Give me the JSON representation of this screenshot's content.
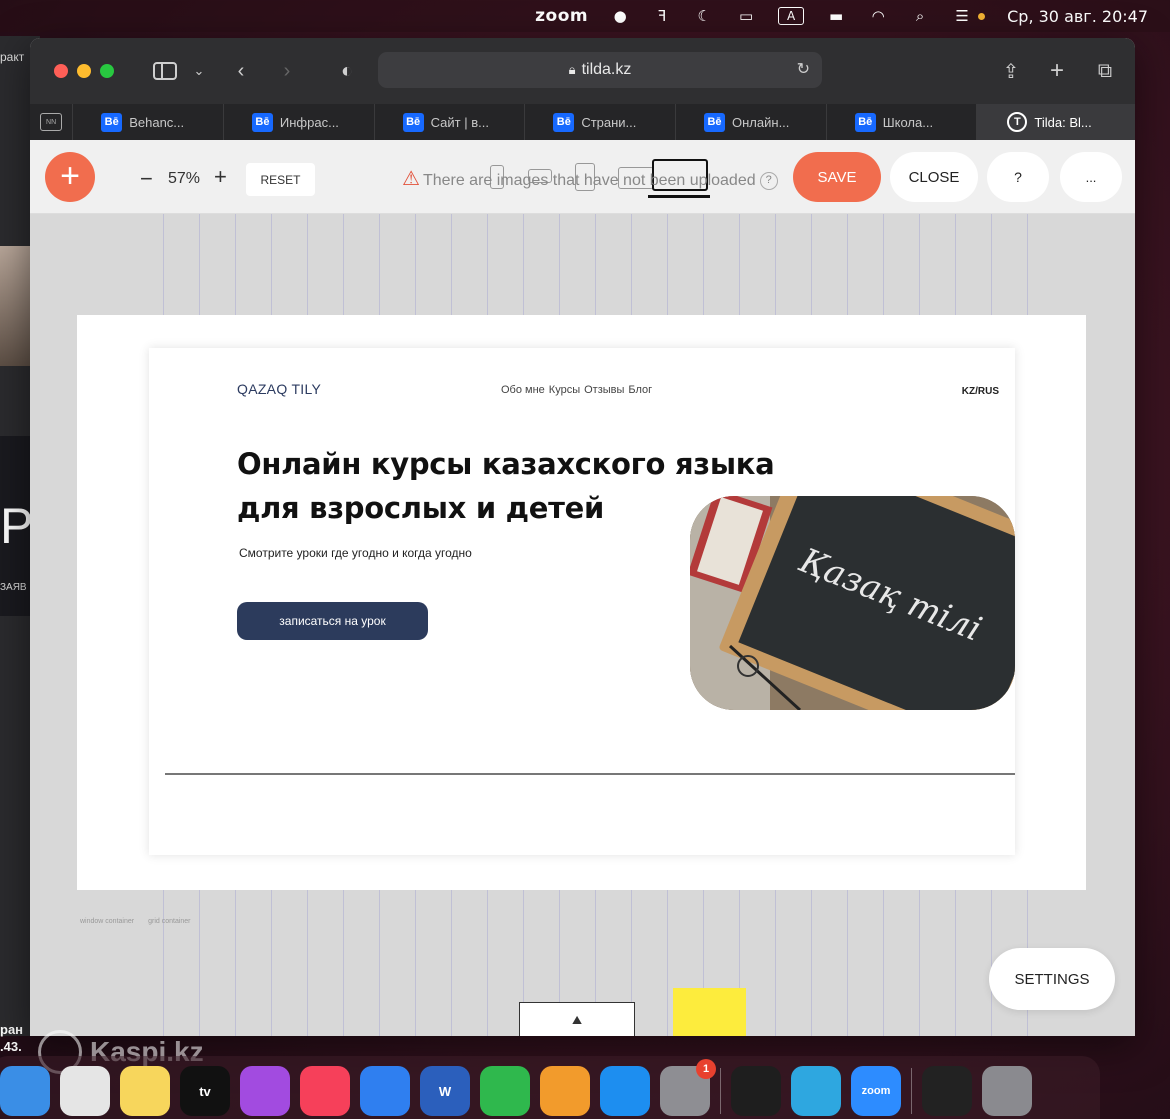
{
  "menubar": {
    "app_name": "zoom",
    "input_source": "A",
    "datetime": "Ср, 30 авг.  20:47"
  },
  "background_window": {
    "title_fragment": "ракт",
    "text1": "ЗАЯВ",
    "text2_line1": "ран",
    "text2_line2": ".43."
  },
  "browser": {
    "url": "tilda.kz",
    "tabs": [
      {
        "label": "Behanc...",
        "icon": "behance-icon"
      },
      {
        "label": "Инфрас...",
        "icon": "behance-icon"
      },
      {
        "label": "Сайт | в...",
        "icon": "behance-icon"
      },
      {
        "label": "Страни...",
        "icon": "behance-icon"
      },
      {
        "label": "Онлайн...",
        "icon": "behance-icon"
      },
      {
        "label": "Школа...",
        "icon": "behance-icon"
      }
    ],
    "active_tab": {
      "label": "Tilda: Bl...",
      "icon": "tilda-icon"
    },
    "behance_glyph": "Bē"
  },
  "toolbar": {
    "zoom_level": "57%",
    "reset_label": "RESET",
    "warning_text": "There are images that have not been uploaded",
    "save_label": "SAVE",
    "close_label": "CLOSE",
    "help_label": "?",
    "more_label": "..."
  },
  "page": {
    "logo": "QAZAQ TILY",
    "nav": [
      "Обо мне",
      "Курсы",
      "Отзывы",
      "Блог"
    ],
    "lang": "KZ/RUS",
    "hero_title": "Онлайн курсы казахского языка для взрослых и детей",
    "hero_subtitle": "Смотрите уроки где угодно и когда угодно",
    "cta": "записаться на урок",
    "image_text": "Қазақ тілі"
  },
  "canvas": {
    "label_window": "window container",
    "label_grid": "grid container",
    "settings_label": "SETTINGS"
  },
  "watermark": "Kaspi.kz",
  "dock": {
    "apps": [
      {
        "name": "finder",
        "color": "#3a8ee6"
      },
      {
        "name": "screenshot",
        "color": "#e5e5e5"
      },
      {
        "name": "notes",
        "color": "#f7d65c"
      },
      {
        "name": "apple-tv",
        "color": "#111111",
        "label": "tv"
      },
      {
        "name": "podcasts",
        "color": "#a24be0"
      },
      {
        "name": "music",
        "color": "#f6405a"
      },
      {
        "name": "keynote",
        "color": "#2f7ff0"
      },
      {
        "name": "word",
        "color": "#2b5fbc",
        "label": "W"
      },
      {
        "name": "numbers",
        "color": "#2fb84d"
      },
      {
        "name": "pages",
        "color": "#f29b2c"
      },
      {
        "name": "app-store",
        "color": "#1d8ef0"
      },
      {
        "name": "system-settings",
        "color": "#8e8e93",
        "badge": "1"
      }
    ],
    "apps2": [
      {
        "name": "figma",
        "color": "#1e1e1e"
      },
      {
        "name": "telegram",
        "color": "#2ea7e0"
      },
      {
        "name": "zoom",
        "color": "#2d8cff",
        "label": "zoom"
      }
    ],
    "apps3": [
      {
        "name": "window-preview",
        "color": "#222222"
      },
      {
        "name": "trash",
        "color": "#8a8a8f"
      }
    ]
  }
}
